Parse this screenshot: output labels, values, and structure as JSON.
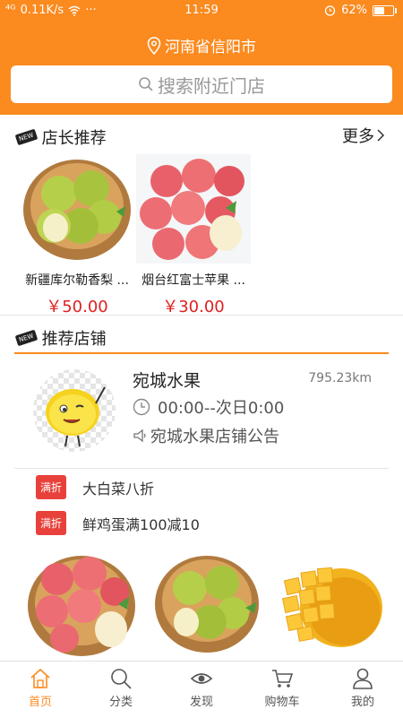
{
  "status_bar": {
    "network": "⁴ᴳ",
    "speed": "0.11K/s",
    "dots": "···",
    "time": "11:59",
    "battery": "62%",
    "battery_level": 0.62
  },
  "header": {
    "location": "河南省信阳市",
    "search_placeholder": "搜索附近门店"
  },
  "manager_recommend": {
    "badge": "NEW",
    "title": "店长推荐",
    "more": "更多",
    "items": [
      {
        "name": "新疆库尔勒香梨 ...",
        "price": "￥50.00"
      },
      {
        "name": "烟台红富士苹果 ...",
        "price": "￥30.00"
      }
    ]
  },
  "recommended_stores": {
    "badge": "NEW",
    "title": "推荐店铺",
    "store": {
      "name": "宛城水果",
      "distance": "795.23km",
      "hours": "00:00--次日0:00",
      "notice": "宛城水果店铺公告"
    },
    "promotions": [
      {
        "badge": "满折",
        "text": "大白菜八折"
      },
      {
        "badge": "满折",
        "text": "鲜鸡蛋满100减10"
      }
    ]
  },
  "tabbar": [
    {
      "label": "首页",
      "icon": "home-icon",
      "active": true
    },
    {
      "label": "分类",
      "icon": "search-icon",
      "active": false
    },
    {
      "label": "发现",
      "icon": "eye-icon",
      "active": false
    },
    {
      "label": "购物车",
      "icon": "cart-icon",
      "active": false
    },
    {
      "label": "我的",
      "icon": "user-icon",
      "active": false
    }
  ],
  "colors": {
    "brand": "#fb8a1f",
    "price": "#e02020",
    "promo": "#e8413b"
  }
}
